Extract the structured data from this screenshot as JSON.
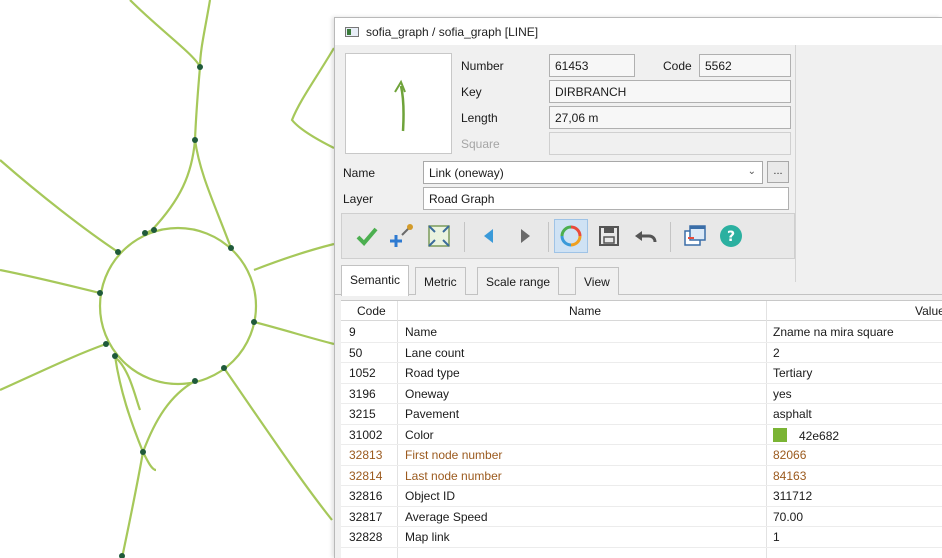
{
  "window": {
    "title": "sofia_graph / sofia_graph [LINE]"
  },
  "properties": {
    "number_label": "Number",
    "number_value": "61453",
    "code_label": "Code",
    "code_value": "5562",
    "key_label": "Key",
    "key_value": "DIRBRANCH",
    "length_label": "Length",
    "length_value": "27,06 m",
    "square_label": "Square",
    "square_value": "",
    "name_label": "Name",
    "name_value": "Link (oneway)",
    "layer_label": "Layer",
    "layer_value": "Road Graph",
    "ellipsis_label": "..."
  },
  "toolbar": {
    "icons": [
      "check-icon",
      "add-vertex-icon",
      "fit-extent-icon",
      "previous-icon",
      "next-icon",
      "refresh-icon",
      "save-icon",
      "undo-icon",
      "copy-window-icon",
      "help-icon"
    ],
    "accent_color": "#3a9ad9",
    "check_color": "#4caf50"
  },
  "tabs": [
    {
      "label": "Semantic",
      "active": true
    },
    {
      "label": "Metric",
      "active": false
    },
    {
      "label": "Scale range",
      "active": false
    },
    {
      "label": "View",
      "active": false
    }
  ],
  "table": {
    "headers": {
      "code": "Code",
      "name": "Name",
      "value": "Value"
    },
    "rows": [
      {
        "code": "9",
        "name": "Name",
        "value": "Zname na mira square"
      },
      {
        "code": "50",
        "name": "Lane count",
        "value": "2"
      },
      {
        "code": "1052",
        "name": "Road type",
        "value": "Tertiary"
      },
      {
        "code": "3196",
        "name": "Oneway",
        "value": "yes"
      },
      {
        "code": "3215",
        "name": "Pavement",
        "value": "asphalt"
      },
      {
        "code": "31002",
        "name": "Color",
        "value": "42e682"
      },
      {
        "code": "32813",
        "name": "First node number",
        "value": "82066"
      },
      {
        "code": "32814",
        "name": "Last node number",
        "value": "84163"
      },
      {
        "code": "32816",
        "name": "Object ID",
        "value": "311712"
      },
      {
        "code": "32817",
        "name": "Average Speed",
        "value": "70.00"
      },
      {
        "code": "32828",
        "name": "Map link",
        "value": "1"
      }
    ]
  },
  "map": {
    "road_color": "#a6c85a",
    "node_color": "#1f5a3a"
  }
}
